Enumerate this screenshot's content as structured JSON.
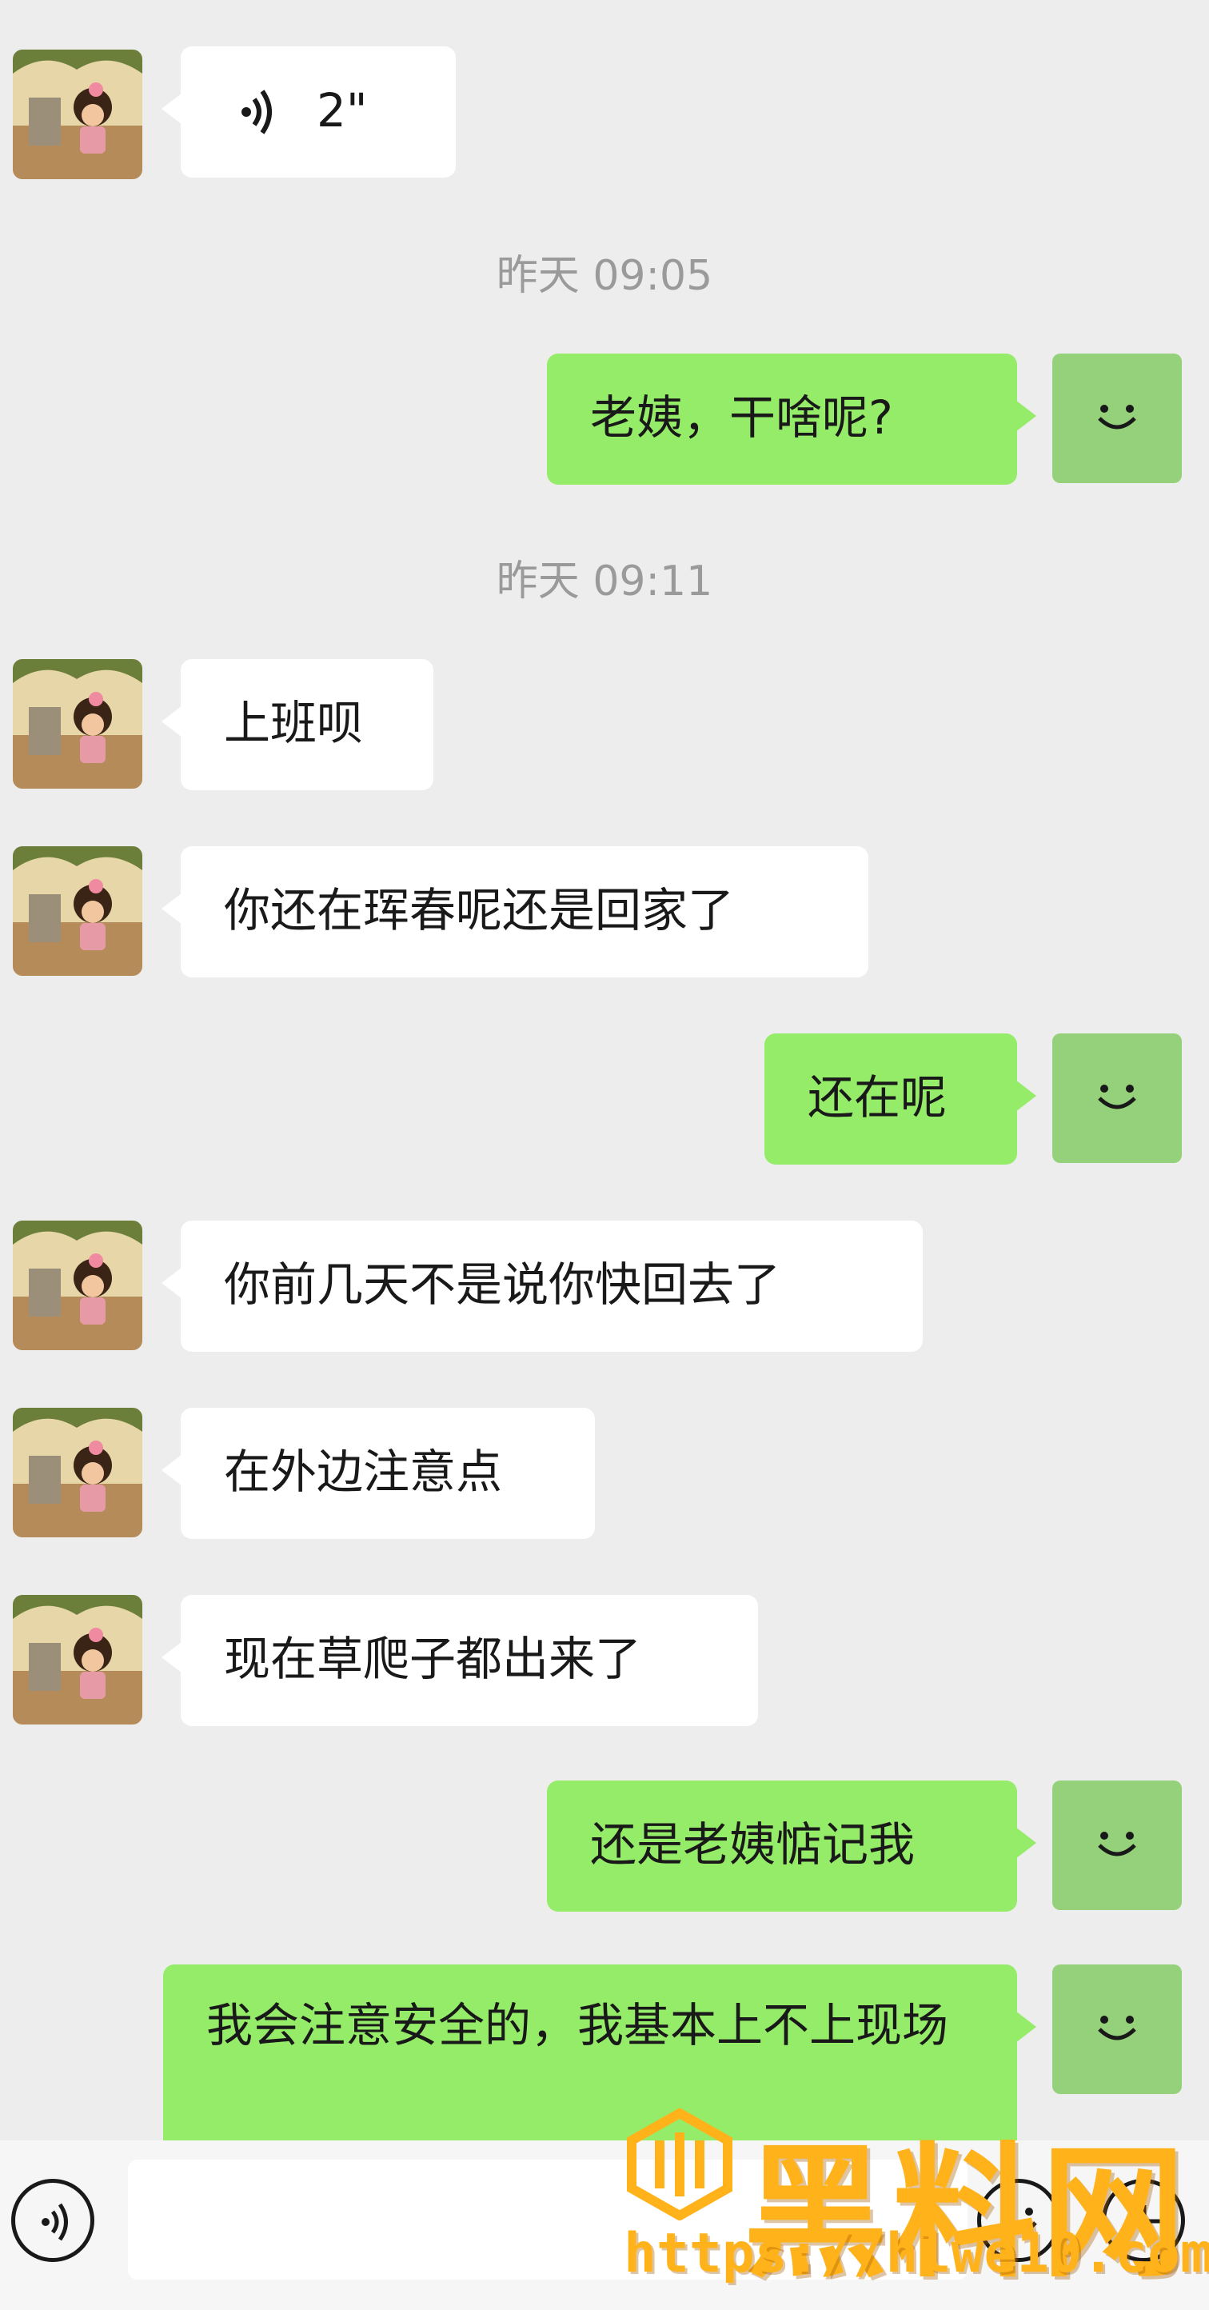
{
  "voice_message": {
    "duration": "2\""
  },
  "timestamps": [
    "昨天 09:05",
    "昨天 09:11"
  ],
  "messages": [
    {
      "side": "right",
      "text": "老姨，干啥呢?"
    },
    {
      "side": "left",
      "text": "上班呗"
    },
    {
      "side": "left",
      "text": "你还在珲春呢还是回家了"
    },
    {
      "side": "right",
      "text": "还在呢"
    },
    {
      "side": "left",
      "text": "你前几天不是说你快回去了"
    },
    {
      "side": "left",
      "text": "在外边注意点"
    },
    {
      "side": "left",
      "text": "现在草爬子都出来了"
    },
    {
      "side": "right",
      "text": "还是老姨惦记我"
    },
    {
      "side": "right",
      "text": "我会注意安全的，我基本上不上现场"
    }
  ],
  "watermark": {
    "logo_text": "黑料网",
    "url": "https://hlwe10.com"
  },
  "colors": {
    "background": "#ededed",
    "sent_bubble": "#95ec69",
    "received_bubble": "#ffffff",
    "self_avatar": "#95d17a",
    "watermark": "#ffb21a"
  },
  "icons": [
    "voice-toggle-icon",
    "emoji-icon",
    "plus-icon",
    "smile-avatar-icon",
    "voice-wave-icon"
  ]
}
